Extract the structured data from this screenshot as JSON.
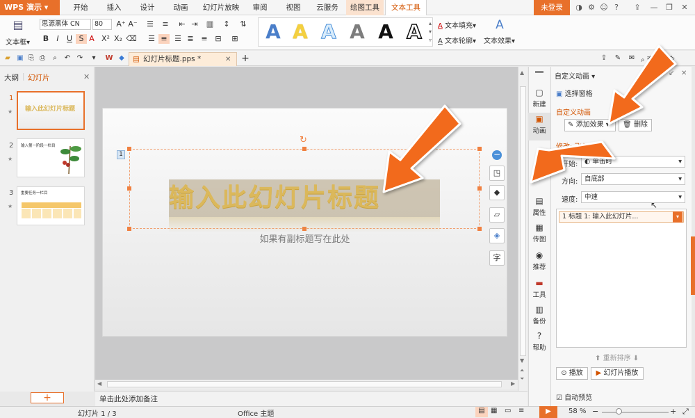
{
  "app": {
    "logo": "WPS 演示"
  },
  "tabs": [
    {
      "label": "开始"
    },
    {
      "label": "插入"
    },
    {
      "label": "设计"
    },
    {
      "label": "动画"
    },
    {
      "label": "幻灯片放映"
    },
    {
      "label": "审阅"
    },
    {
      "label": "视图"
    },
    {
      "label": "云服务"
    },
    {
      "label": "绘图工具"
    },
    {
      "label": "文本工具"
    }
  ],
  "login": "未登录",
  "ribbon": {
    "textbox": "文本框",
    "font_name": "思源黑体 CN",
    "font_size": "80",
    "bold": "B",
    "italic": "I",
    "underline": "U",
    "shadow": "S",
    "text_fill": "文本填充",
    "text_outline": "文本轮廓",
    "text_effect": "文本效果",
    "wordart_glyph": "A"
  },
  "document": {
    "tab_title": "幻灯片标题.pps *"
  },
  "left_panel": {
    "outline_tab": "大纲",
    "slides_tab": "幻灯片",
    "slide_numbers": [
      "1",
      "2",
      "3"
    ]
  },
  "slide": {
    "title": "输入此幻灯片标题",
    "subtitle": "如果有副标题写在此处",
    "anim_index": "1"
  },
  "thumbs": {
    "t1": "输入此幻灯片标题",
    "t2": "输入第一阶段一栏目",
    "t3": "重要任务一栏目"
  },
  "rail": [
    "新建",
    "动画",
    "属性",
    "传图",
    "推荐",
    "工具",
    "备份",
    "帮助"
  ],
  "pane": {
    "title": "自定义动画",
    "select_pane": "选择窗格",
    "section": "自定义动画",
    "add_effect": "添加效果",
    "delete": "删除",
    "modify": "修改: 飞入",
    "start_label": "开始:",
    "start_value": "单击时",
    "direction_label": "方向:",
    "direction_value": "自底部",
    "speed_label": "速度:",
    "speed_value": "中速",
    "list_item": "1  标题 1: 输入此幻灯片...",
    "reorder": "重新排序",
    "play": "播放",
    "slideshow": "幻灯片播放",
    "auto_preview": "自动预览"
  },
  "notes": "单击此处添加备注",
  "status": {
    "slide_count": "幻灯片 1 / 3",
    "theme": "Office 主题",
    "zoom": "58 %"
  },
  "colors": {
    "accent": "#e8702a",
    "arrow": "#f26a1b"
  }
}
